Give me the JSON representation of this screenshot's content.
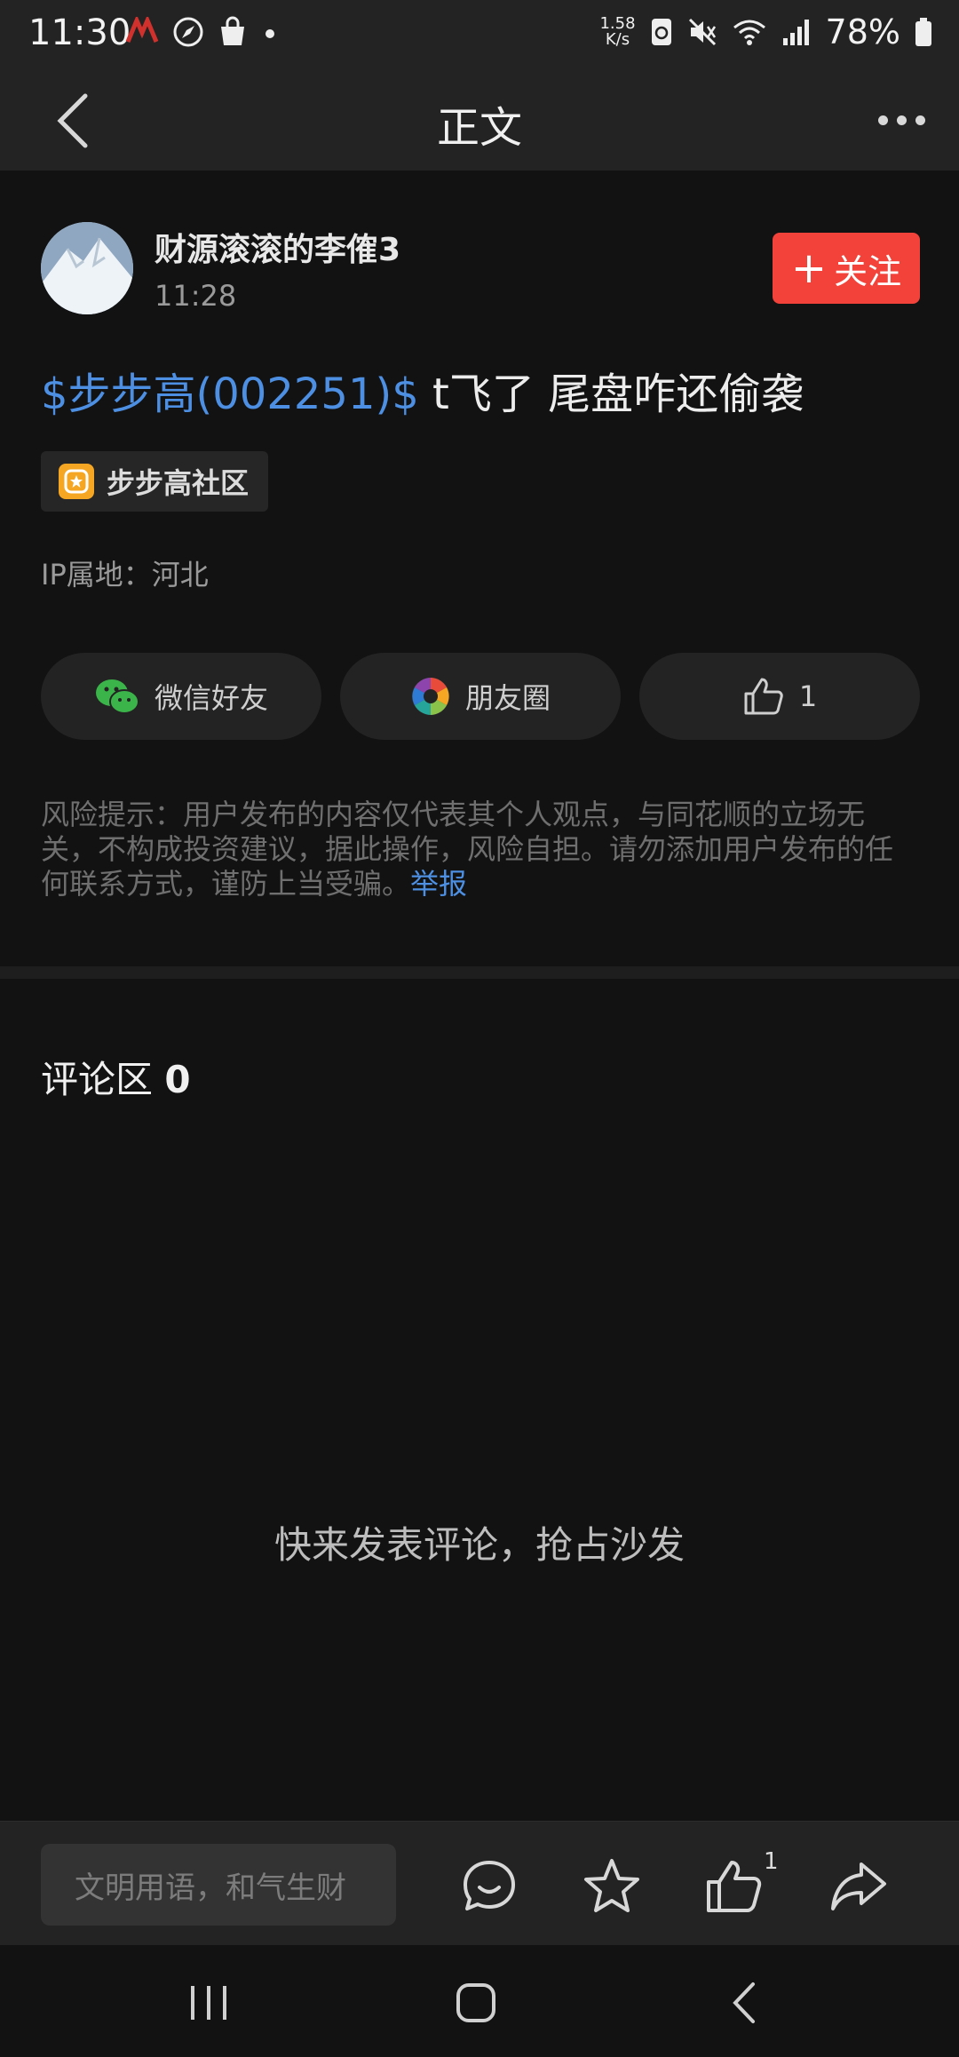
{
  "status_bar": {
    "time": "11:30",
    "net_speed_value": "1.58",
    "net_speed_unit": "K/s",
    "battery": "78%",
    "icons": [
      "app-icon",
      "compass-icon",
      "bag-icon",
      "dot-icon",
      "sync-icon",
      "mute-icon",
      "wifi-icon",
      "signal-icon",
      "battery-icon"
    ]
  },
  "nav": {
    "title": "正文",
    "back_icon": "chevron-left-icon",
    "more_icon": "more-dots-icon"
  },
  "author": {
    "name": "财源滚滚的李傕3",
    "time": "11:28",
    "follow_label": "关注"
  },
  "post": {
    "stock_tag": "$步步高(002251)$",
    "text": " t飞了 尾盘咋还偷袭",
    "community": "步步高社区",
    "ip_location": "IP属地：河北"
  },
  "share": {
    "wechat_label": "微信好友",
    "moments_label": "朋友圈",
    "like_count": "1"
  },
  "risk_notice": {
    "text": "风险提示：用户发布的内容仅代表其个人观点，与同花顺的立场无关，不构成投资建议，据此操作，风险自担。请勿添加用户发布的任何联系方式，谨防上当受骗。",
    "report_link": "举报"
  },
  "comments": {
    "title": "评论区",
    "count": "0",
    "empty_hint": "快来发表评论，抢占沙发"
  },
  "bottom_bar": {
    "input_placeholder": "文明用语，和气生财",
    "like_count": "1"
  },
  "colors": {
    "accent_blue": "#4d8fe2",
    "follow_red": "#f2423a",
    "background": "#121212",
    "surface": "#232323"
  }
}
